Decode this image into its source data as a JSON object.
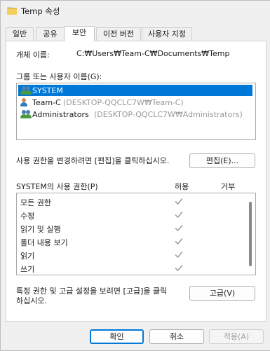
{
  "window": {
    "title": "Temp 속성"
  },
  "tabs": [
    {
      "label": "일반"
    },
    {
      "label": "공유"
    },
    {
      "label": "보안"
    },
    {
      "label": "이전 버전"
    },
    {
      "label": "사용자 지정"
    }
  ],
  "security": {
    "object_label": "개체 이름:",
    "object_path": "C:₩Users₩Team-C₩Documents₩Temp",
    "groups_label": "그룹 또는 사용자 이름(G):",
    "users": [
      {
        "name": "SYSTEM",
        "suffix": "",
        "icon": "user-group-icon",
        "selected": true
      },
      {
        "name": "Team-C",
        "suffix": "(DESKTOP-QQCLC7W₩Team-C)",
        "icon": "user-icon",
        "selected": false
      },
      {
        "name": "Administrators",
        "suffix": "(DESKTOP-QQCLC7W₩Administrators)",
        "icon": "user-group-icon",
        "selected": false
      }
    ],
    "edit_hint": "사용 권한을 변경하려면 [편집]을 클릭하십시오.",
    "edit_button": "편집(E)...",
    "perm_header": "SYSTEM의 사용 권한(P)",
    "allow_header": "허용",
    "deny_header": "거부",
    "permissions": [
      {
        "name": "모든 권한",
        "allow": true,
        "deny": false
      },
      {
        "name": "수정",
        "allow": true,
        "deny": false
      },
      {
        "name": "읽기 및 실행",
        "allow": true,
        "deny": false
      },
      {
        "name": "폴더 내용 보기",
        "allow": true,
        "deny": false
      },
      {
        "name": "읽기",
        "allow": true,
        "deny": false
      },
      {
        "name": "쓰기",
        "allow": true,
        "deny": false
      }
    ],
    "advanced_hint_line1": "특정 권한 및 고급 설정을 보려면 [고급]을 클릭",
    "advanced_hint_line2": "하십시오.",
    "advanced_button": "고급(V)"
  },
  "footer": {
    "ok": "확인",
    "cancel": "취소",
    "apply": "적용(A)"
  },
  "colors": {
    "selection": "#0078d7",
    "checkmark": "#9a9a9a"
  }
}
